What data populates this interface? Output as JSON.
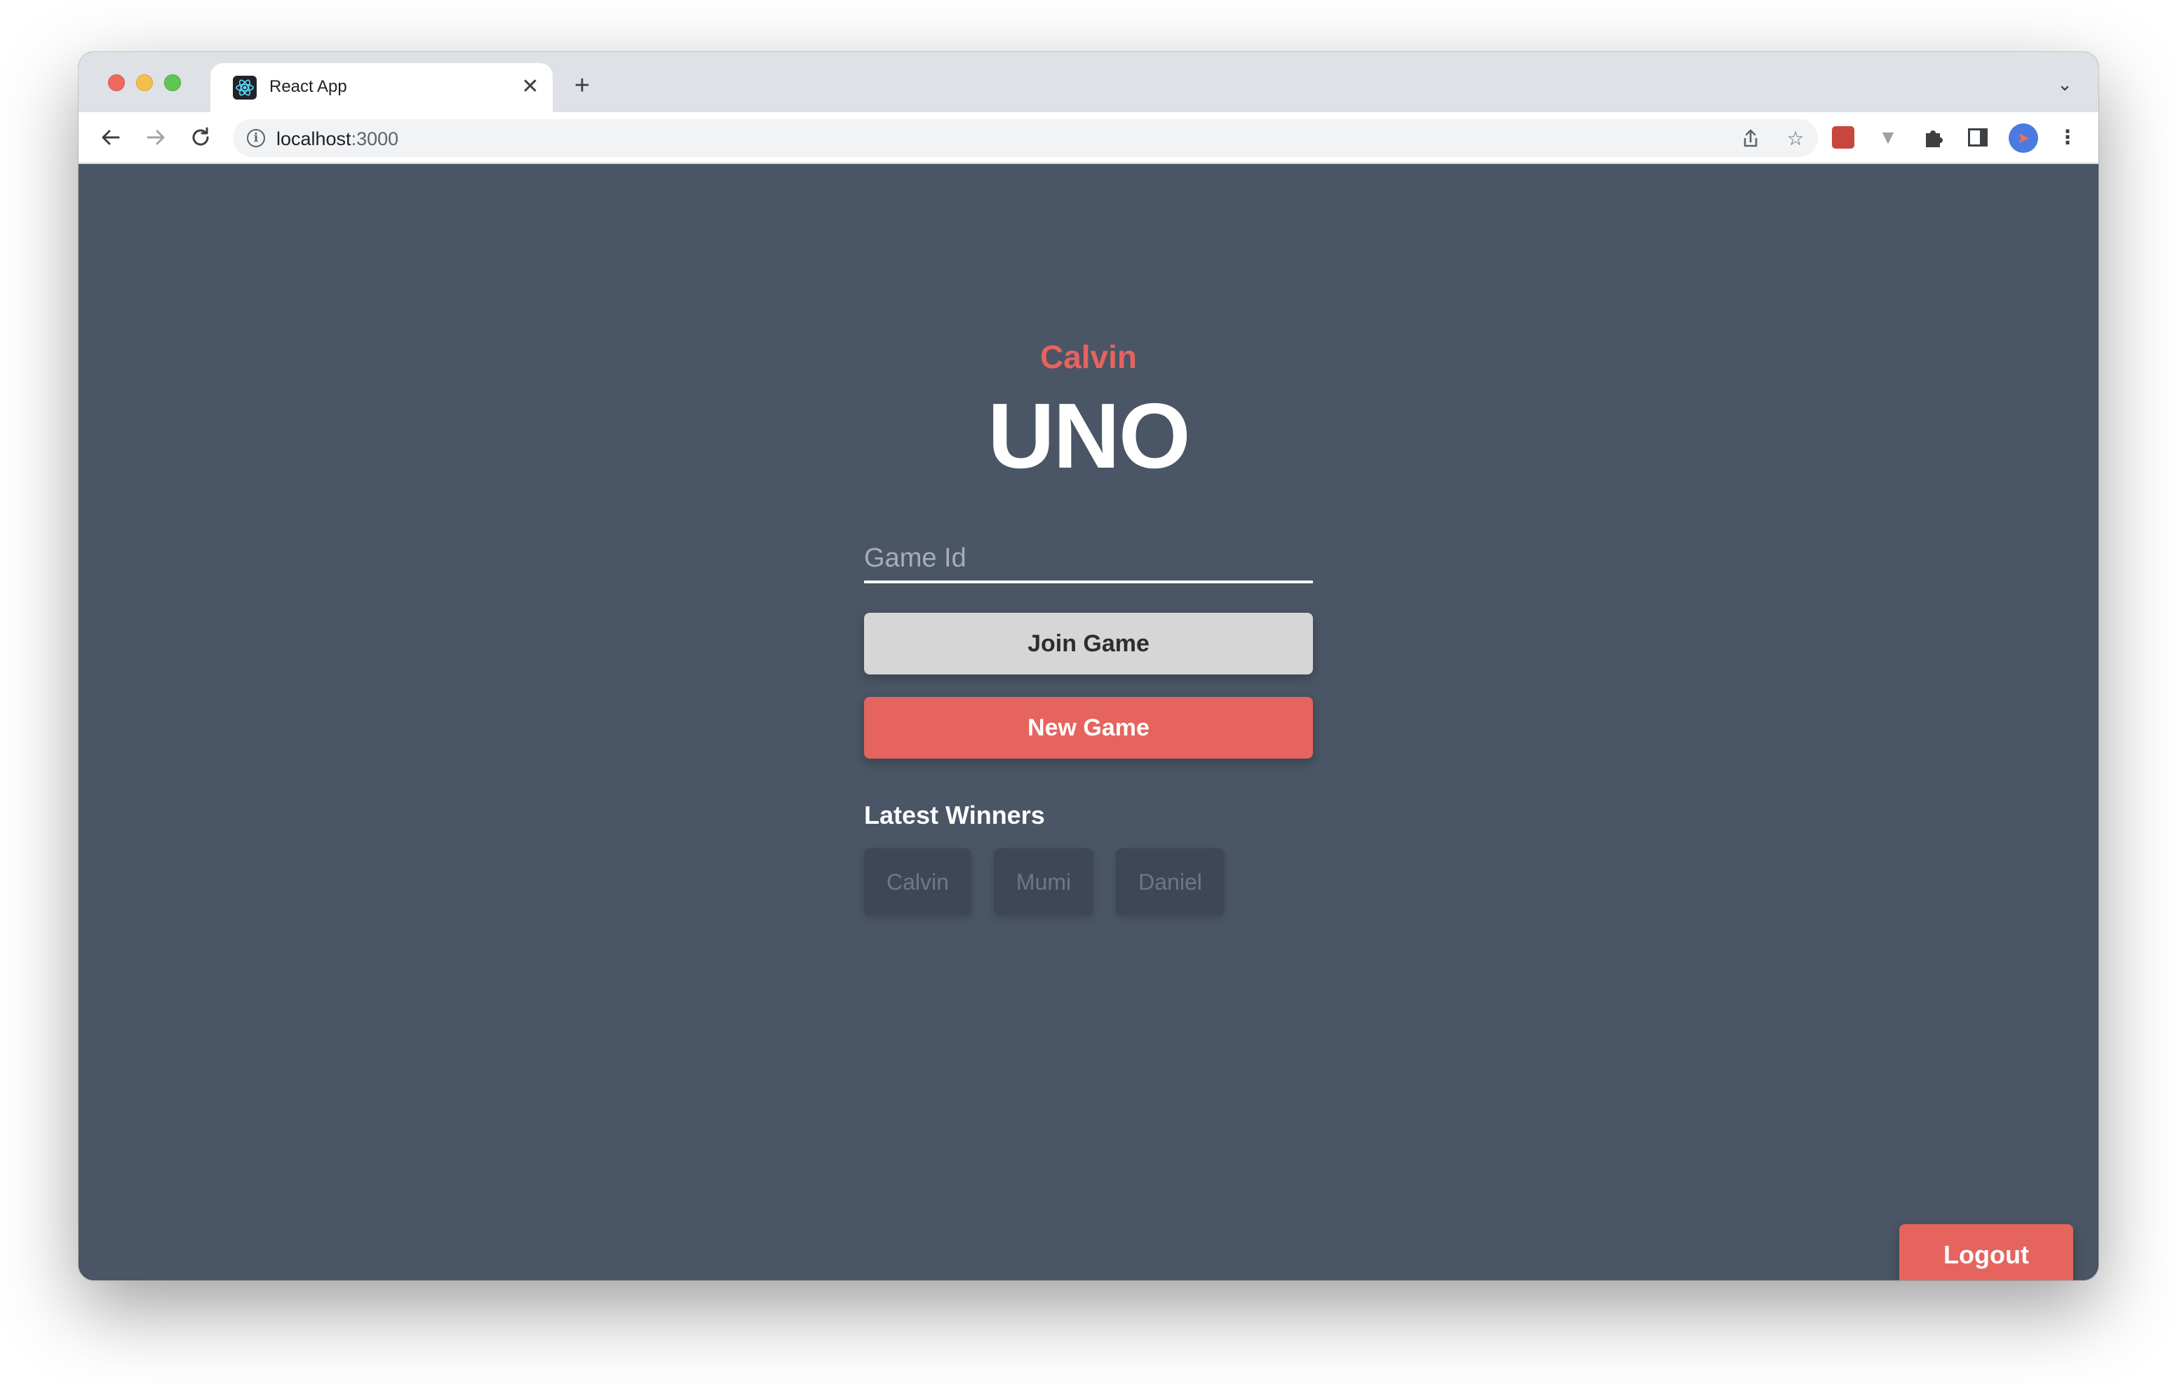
{
  "browser": {
    "tab_title": "React App",
    "url_host": "localhost",
    "url_port": ":3000",
    "icons": [
      "back-arrow-icon",
      "forward-arrow-icon",
      "reload-icon",
      "info-icon",
      "share-icon",
      "star-icon",
      "extensions-icon",
      "side-panel-icon",
      "profile-avatar",
      "more-menu-icon"
    ]
  },
  "main": {
    "player_name": "Calvin",
    "title": "UNO",
    "game_id_placeholder": "Game Id",
    "join_label": "Join Game",
    "new_game_label": "New Game",
    "winners_heading": "Latest Winners",
    "winners": [
      "Calvin",
      "Mumi",
      "Daniel"
    ],
    "logout_label": "Logout"
  },
  "colors": {
    "background": "#4a5565",
    "accent": "#e5645e",
    "join_button": "#d6d6d6",
    "winner_chip": "#3e4755"
  }
}
